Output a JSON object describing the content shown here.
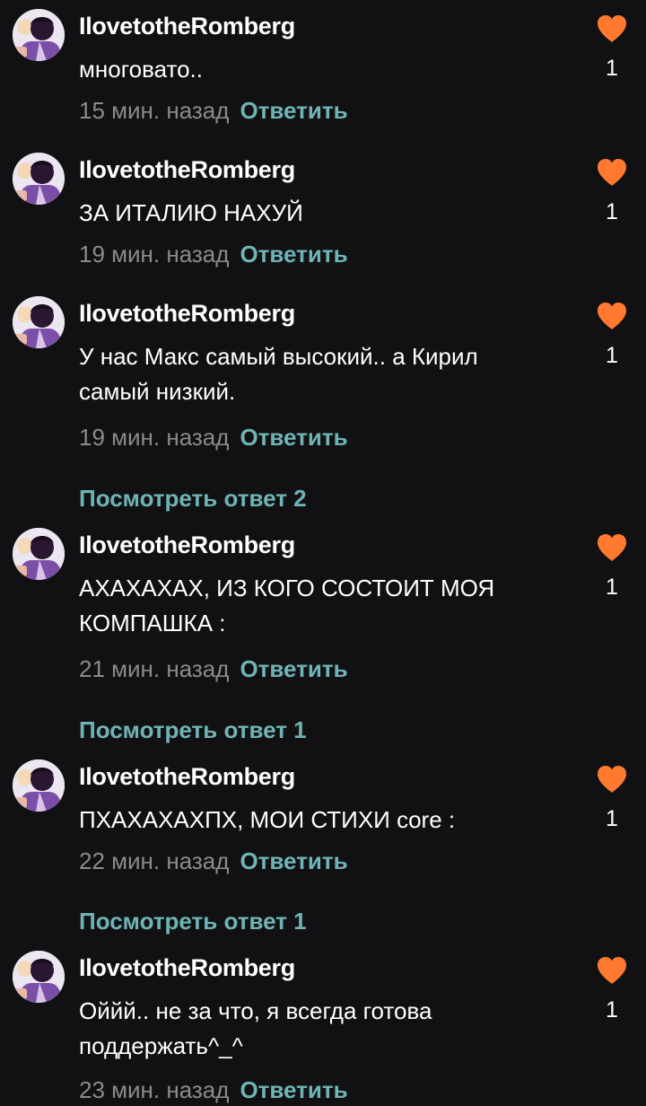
{
  "colors": {
    "background": "#111113",
    "accent": "#6fb4b5",
    "heart": "#ff7a2f",
    "muted": "#8b8b8e"
  },
  "comments": [
    {
      "username": "IlovetotheRomberg",
      "text": "многовато..",
      "time": "15 мин. назад",
      "reply": "Ответить",
      "likes": "1"
    },
    {
      "username": "IlovetotheRomberg",
      "text": "ЗА ИТАЛИЮ НАХУЙ",
      "time": "19 мин. назад",
      "reply": "Ответить",
      "likes": "1"
    },
    {
      "username": "IlovetotheRomberg",
      "text": "У нас Макс самый высокий.. а Кирил самый низкий.",
      "time": "19 мин. назад",
      "reply": "Ответить",
      "likes": "1"
    },
    {
      "username": "IlovetotheRomberg",
      "text": "АХАХАХАХ, ИЗ КОГО СОСТОИТ МОЯ КОМПАШКА :",
      "time": "21 мин. назад",
      "reply": "Ответить",
      "likes": "1"
    },
    {
      "username": "IlovetotheRomberg",
      "text": "ПХАХАХАХПХ, МОИ СТИХИ core :",
      "time": "22 мин. назад",
      "reply": "Ответить",
      "likes": "1"
    },
    {
      "username": "IlovetotheRomberg",
      "text": "Оййй.. не за что, я всегда готова поддержать^_^",
      "time": "23 мин. назад",
      "reply": "Ответить",
      "likes": "1"
    }
  ],
  "view_replies": [
    {
      "label": "Посмотреть ответ 2"
    },
    {
      "label": "Посмотреть ответ 1"
    },
    {
      "label": "Посмотреть ответ 1"
    }
  ]
}
